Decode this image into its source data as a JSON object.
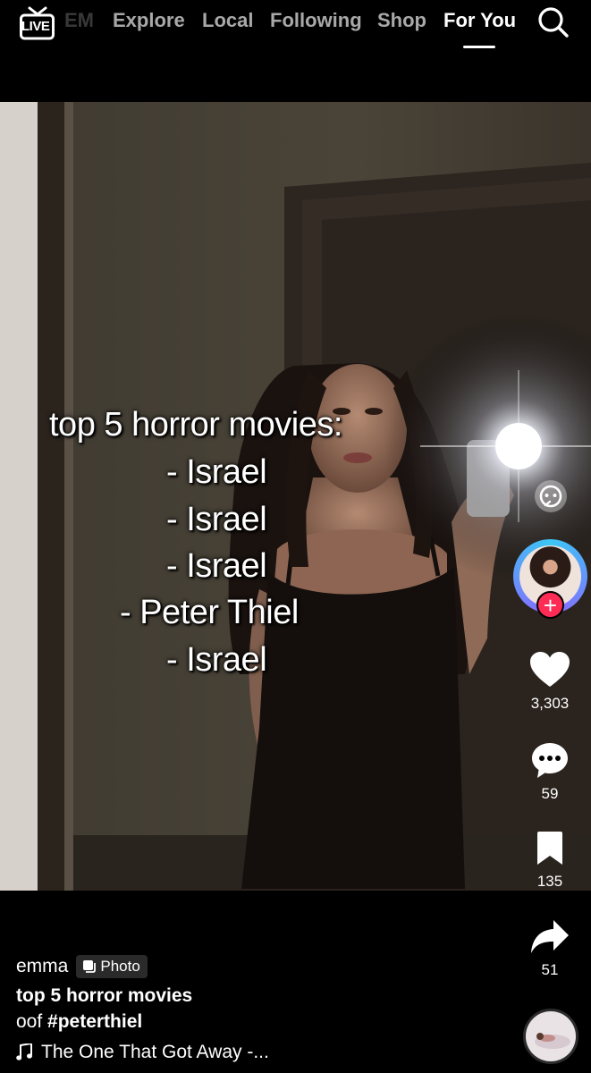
{
  "nav": {
    "live_label": "LIVE",
    "faded_item": "EM",
    "items": [
      "Explore",
      "Local",
      "Following",
      "Shop",
      "For You"
    ],
    "active": "For You"
  },
  "overlay_lines": [
    "top 5 horror movies:",
    "- Israel",
    "- Israel",
    "- Israel",
    "- Peter Thiel",
    "- Israel"
  ],
  "actions": {
    "likes": "3,303",
    "comments": "59",
    "saves": "135",
    "shares": "51"
  },
  "post": {
    "username": "emma",
    "badge": "Photo",
    "title": "top 5 horror movies",
    "caption_prefix": "oof ",
    "hashtag": "#peterthiel",
    "music": "The One That Got Away -..."
  },
  "colors": {
    "follow_plus": "#fe2c55",
    "avatar_ring": "#3bc6f5"
  },
  "icons": [
    "live-icon",
    "search-icon",
    "quote-icon",
    "heart-icon",
    "comment-icon",
    "bookmark-icon",
    "share-icon",
    "music-note-icon",
    "photo-badge-icon"
  ]
}
